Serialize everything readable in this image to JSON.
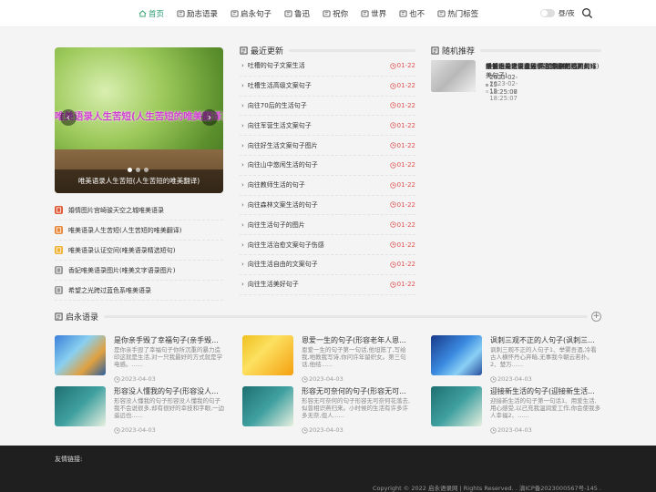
{
  "nav": {
    "items": [
      {
        "label": "首页",
        "active": true
      },
      {
        "label": "励志语录",
        "active": false
      },
      {
        "label": "启永句子",
        "active": false
      },
      {
        "label": "鲁迅",
        "active": false
      },
      {
        "label": "祝你",
        "active": false
      },
      {
        "label": "世界",
        "active": false
      },
      {
        "label": "也不",
        "active": false
      },
      {
        "label": "热门标签",
        "active": false
      }
    ],
    "theme_label": "昼/夜"
  },
  "slider": {
    "overlay_text": "唯美语录人生苦短(人生苦短的唯美翻译)",
    "caption": "唯美语录人生苦短(人生苦短的唯美翻译)",
    "prev": "‹",
    "next": "›"
  },
  "left_list": [
    {
      "label": "婚情图片宫崎骏天空之城唯美语录",
      "color": "#e05a3a"
    },
    {
      "label": "唯美语录人生苦短(人生苦短的唯美翻译)",
      "color": "#e8883a"
    },
    {
      "label": "唯美语录认证空间(唯美语录精选短句)",
      "color": "#f0b030"
    },
    {
      "label": "香妃唯美语录图片(唯美文字语录图片)",
      "color": "#999999"
    },
    {
      "label": "希望之光跨过蓝色系唯美语录",
      "color": "#999999"
    }
  ],
  "latest": {
    "title": "最近更新",
    "arrow": "›",
    "items": [
      {
        "title": "吐槽的句子文案生活",
        "date": "01-22"
      },
      {
        "title": "吐槽生活高级文案句子",
        "date": "01-22"
      },
      {
        "title": "向往70后的生活句子",
        "date": "01-22"
      },
      {
        "title": "向往军营生活文案句子",
        "date": "01-22"
      },
      {
        "title": "向往好生活文案句子图片",
        "date": "01-22"
      },
      {
        "title": "向往山中悠闲生活的句子",
        "date": "01-22"
      },
      {
        "title": "向往教师生活的句子",
        "date": "01-22"
      },
      {
        "title": "向往森林文案生活的句子",
        "date": "01-22"
      },
      {
        "title": "向往生活句子的图片",
        "date": "01-22"
      },
      {
        "title": "向往生活治愈文案句子伤感",
        "date": "01-22"
      },
      {
        "title": "向往生活自由的文案句子",
        "date": "01-22"
      },
      {
        "title": "向往生活美好句子",
        "date": "01-22"
      }
    ]
  },
  "random": {
    "title": "随机推荐",
    "items": [
      {
        "title": "婚情图片宫崎骏天空之城唯美语录",
        "time": "2023-02-15 18:25:08"
      },
      {
        "title": "唯美语录人生苦短(人生苦短的唯美翻译)",
        "time": "2023-02-15 18:25:08"
      },
      {
        "title": "唯美语录认证空间(唯美语录精选短句)",
        "time": "2023-02-15 18:25:08"
      },
      {
        "title": "香妃唯美语录图片(唯美文字语录图片)",
        "time": "2023-02-15 18:25:07"
      },
      {
        "title": "希望之光跨过蓝色系唯美语录",
        "time": "2023-02-15 18:25:07"
      },
      {
        "title": "黑与白的早安唯美语录情感(黑与白的唯美句子)",
        "time": "2023-02-15 18:25:07"
      }
    ]
  },
  "quotes": {
    "title": "启永语录",
    "plus": "+",
    "cards": [
      {
        "title": "是你亲手毁了幸福句子(亲手毁...",
        "desc": "是你亲手毁了幸福句子你所沉重的暴力造印这就是生活,对一只我最好的方式就是学电感。......",
        "date": "2023-04-03"
      },
      {
        "title": "恩爱一生的句子(形容老年人恩...",
        "desc": "恩爱一生的句子第一句话,他坦陈了,写给我,地教我写诗,你问许年留织女。第三句话,他结......",
        "date": "2023-04-03"
      },
      {
        "title": "讽刺三观不正的人句子(讽刺三...",
        "desc": "讽刺三观不正的人句子1、举雾吾酒,冷看古人横怀丹心弃暗,无事我今朝云若扑。2、楚万......",
        "date": "2023-04-03"
      },
      {
        "title": "形容没人懂我的句子(形容没人...",
        "desc": "形容没人懂我的句子形容没人懂我的句子我不会说很多,却有很好的幸技和字眼,一边遥远也......",
        "date": "2023-04-03"
      },
      {
        "title": "形容无可奈何的句子(形容无可...",
        "desc": "形容无可奈何的句子形容无可奈何花落去,似曾相识燕归来。小时候的生活有许多许多无奈,但人......",
        "date": "2023-04-03"
      },
      {
        "title": "迎接新生活的句子(迎接新生活...",
        "desc": "迎接新生活的句子第一句话1、用爱生活,用心感受,以己充我温润爱工作,你会使我多人幸福2、......",
        "date": "2023-04-03"
      }
    ]
  },
  "footer": {
    "friend_links": "友情链接:",
    "copyright": "Copyright © 2022 启永语录网 | Rights Reserved. . 滇ICP备2023000567号-145 ."
  },
  "colors": {
    "accent": "#2a9d6f",
    "date_red": "#e05050",
    "footer_bg": "#1f1f1f"
  }
}
